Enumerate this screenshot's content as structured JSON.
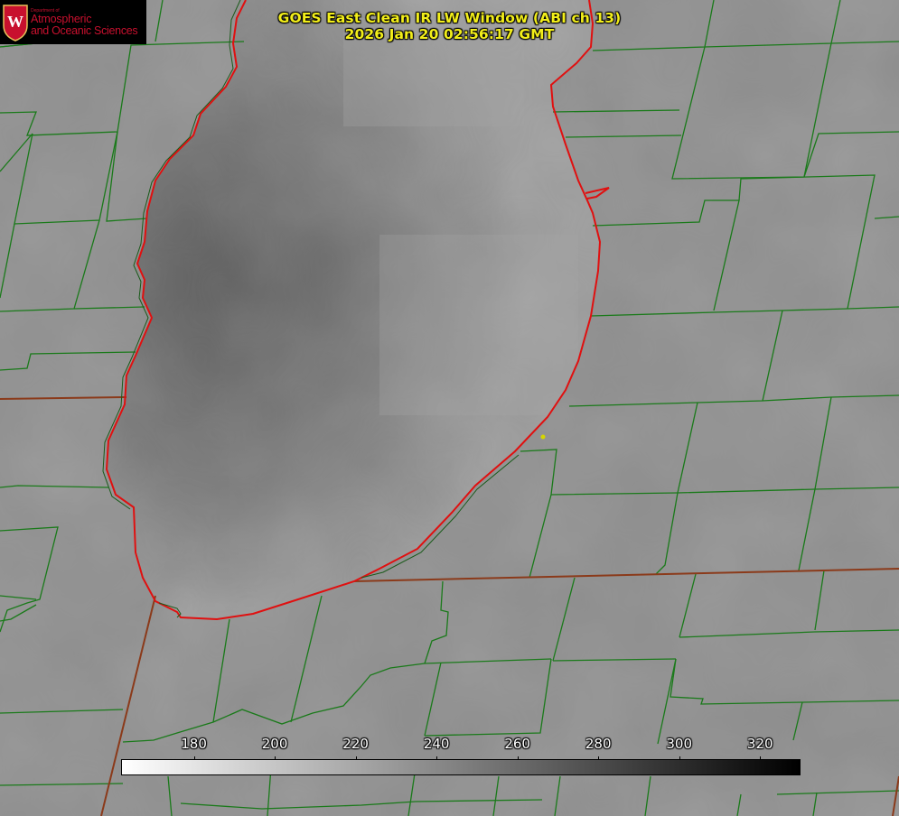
{
  "title": {
    "line1": "GOES East Clean IR LW Window (ABI ch 13)",
    "line2": "2026 Jan 20 02:56:17 GMT",
    "color": "#f2ee1a"
  },
  "logo": {
    "department": "Department of",
    "line1": "Atmospheric",
    "line2": "and Oceanic Sciences",
    "crest_letter": "W",
    "color": "#c8102e"
  },
  "colorbar": {
    "ticks": [
      {
        "value": 180,
        "label": "180"
      },
      {
        "value": 200,
        "label": "200"
      },
      {
        "value": 220,
        "label": "220"
      },
      {
        "value": 240,
        "label": "240"
      },
      {
        "value": 260,
        "label": "260"
      },
      {
        "value": 280,
        "label": "280"
      },
      {
        "value": 300,
        "label": "300"
      },
      {
        "value": 320,
        "label": "320"
      }
    ],
    "min": 162,
    "max": 330,
    "low_color": "#ffffff",
    "high_color": "#000000"
  },
  "map": {
    "county_line_color": "#1a7a1a",
    "state_line_color": "#8b3a1a",
    "lake_outline_color": "#e01010",
    "station_marker_color": "#d6d600",
    "land_base_color": "#8f8f8f",
    "lake_base_color": "#9a9a9a"
  }
}
